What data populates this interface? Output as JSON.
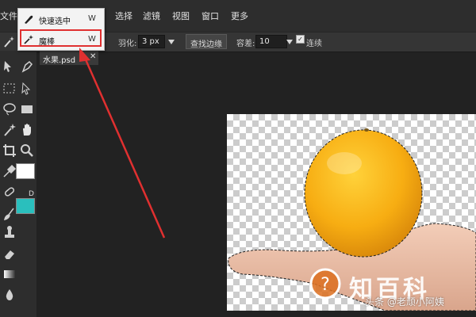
{
  "menu": {
    "items": [
      {
        "label": "文件"
      },
      {
        "label": "选择"
      },
      {
        "label": "滤镜"
      },
      {
        "label": "视图"
      },
      {
        "label": "窗口"
      },
      {
        "label": "更多"
      }
    ]
  },
  "tool_dropdown": {
    "items": [
      {
        "label": "快速选中",
        "shortcut": "W",
        "icon": "quick-select-icon"
      },
      {
        "label": "魔棒",
        "shortcut": "W",
        "icon": "magic-wand-icon",
        "highlighted": true
      }
    ]
  },
  "options": {
    "feather_label": "羽化:",
    "feather_value": "3 px",
    "refine_edge_label": "查找边缘",
    "tolerance_label": "容差:",
    "tolerance_value": "10",
    "contiguous_label": "连续",
    "contiguous_checked": true
  },
  "document": {
    "tab_label": "水果.psd",
    "close_glyph": "✕"
  },
  "swatches": {
    "foreground": "#ffffff",
    "background": "#2abfbd"
  },
  "colors": {
    "annotation": "#e03030"
  },
  "watermark": {
    "brand": "知百科",
    "credit": "头条 @老顽小阿姨"
  }
}
